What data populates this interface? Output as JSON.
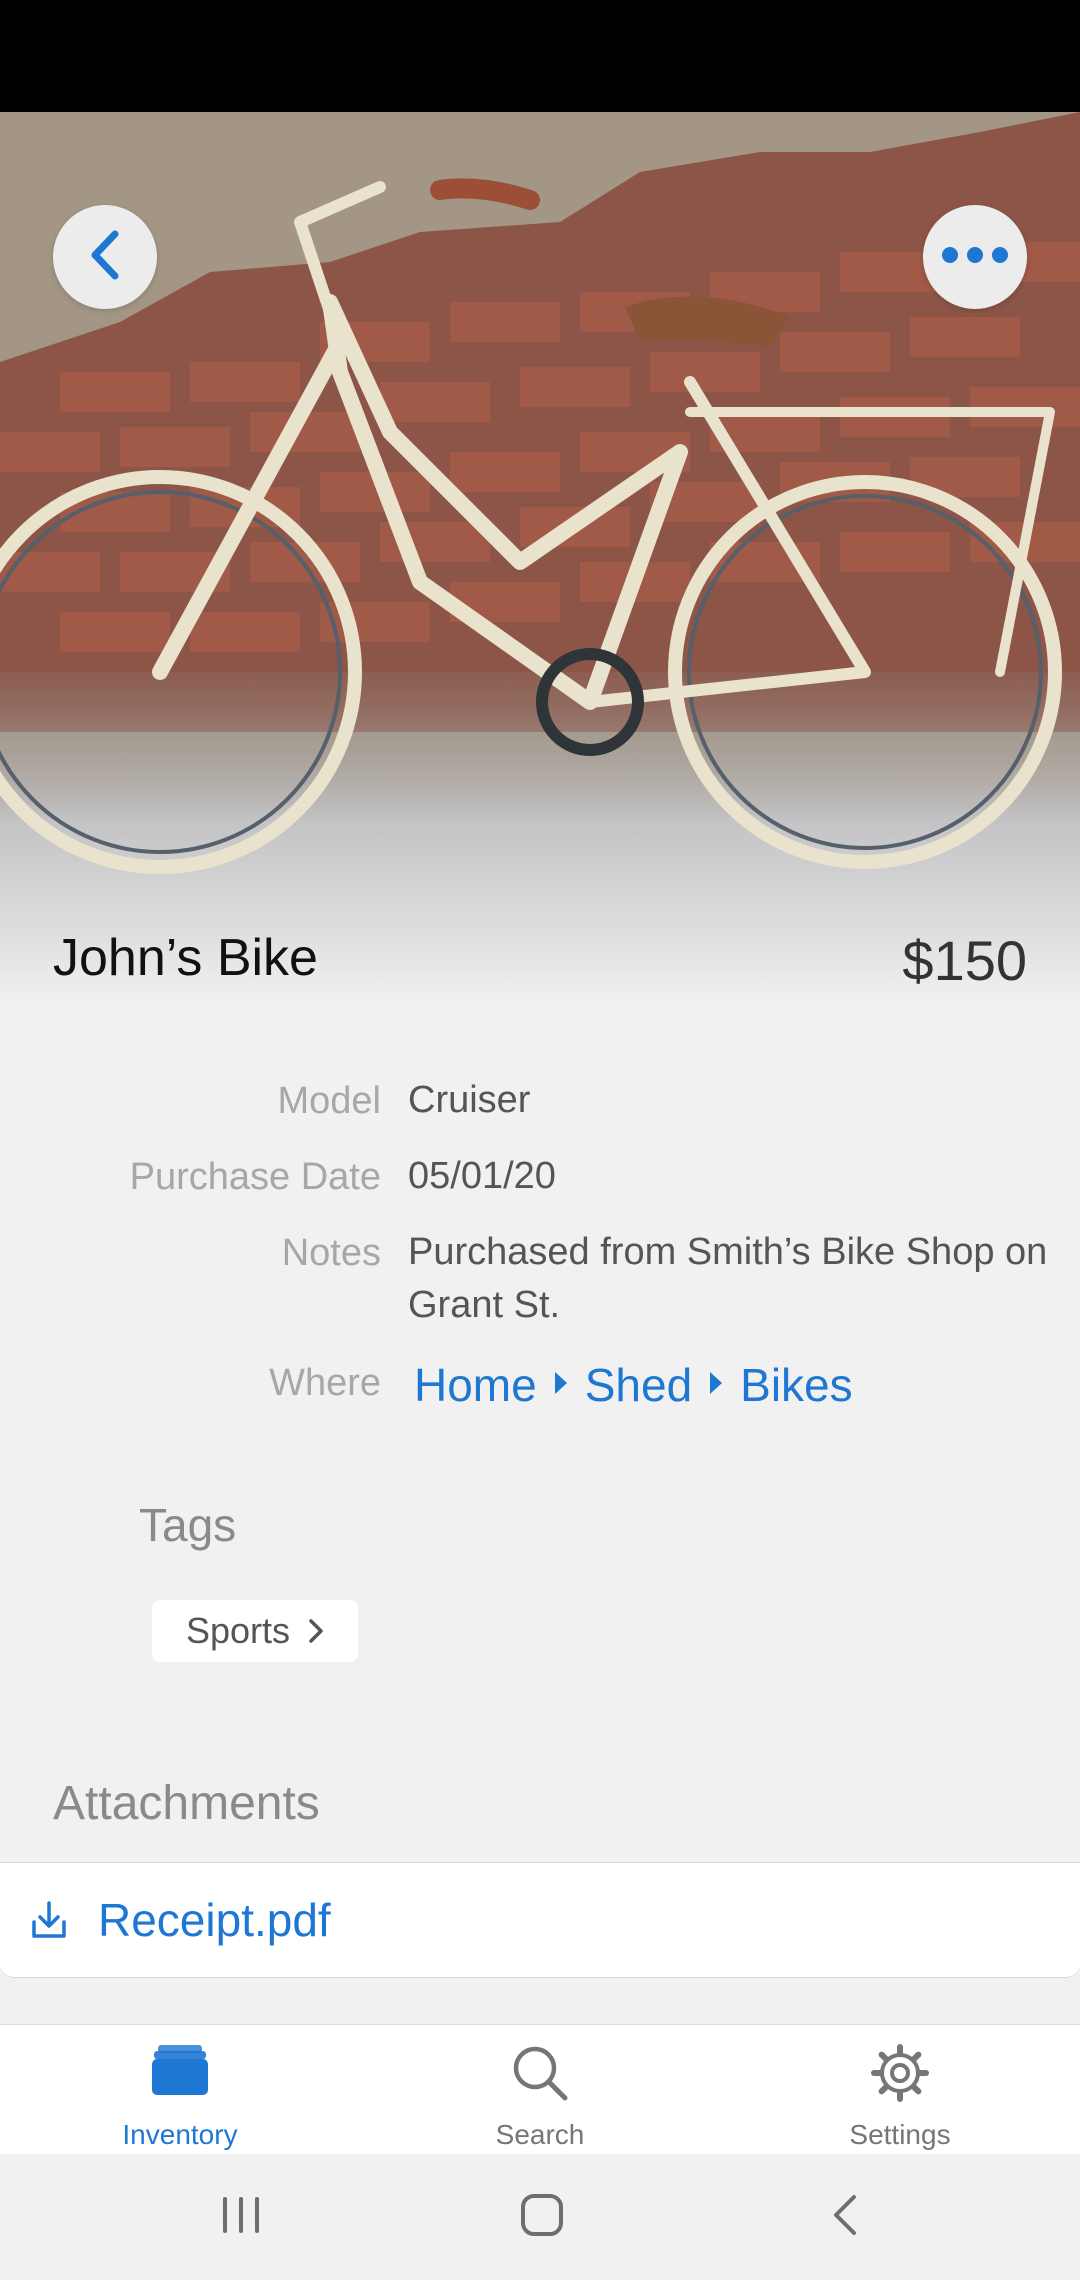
{
  "item": {
    "title": "John’s Bike",
    "price": "$150"
  },
  "details": {
    "model_label": "Model",
    "model_value": "Cruiser",
    "purchase_date_label": "Purchase Date",
    "purchase_date_value": "05/01/20",
    "notes_label": "Notes",
    "notes_value": "Purchased from Smith’s Bike Shop on Grant St.",
    "where_label": "Where",
    "where_path": [
      "Home",
      "Shed",
      "Bikes"
    ]
  },
  "tags": {
    "title": "Tags",
    "items": [
      "Sports"
    ]
  },
  "attachments": {
    "title": "Attachments",
    "items": [
      "Receipt.pdf"
    ]
  },
  "tabs": [
    {
      "label": "Inventory",
      "icon": "inventory-icon",
      "active": true
    },
    {
      "label": "Search",
      "icon": "search-icon",
      "active": false
    },
    {
      "label": "Settings",
      "icon": "gear-icon",
      "active": false
    }
  ],
  "colors": {
    "accent": "#1e77d3",
    "background": "#f1f1f1"
  }
}
